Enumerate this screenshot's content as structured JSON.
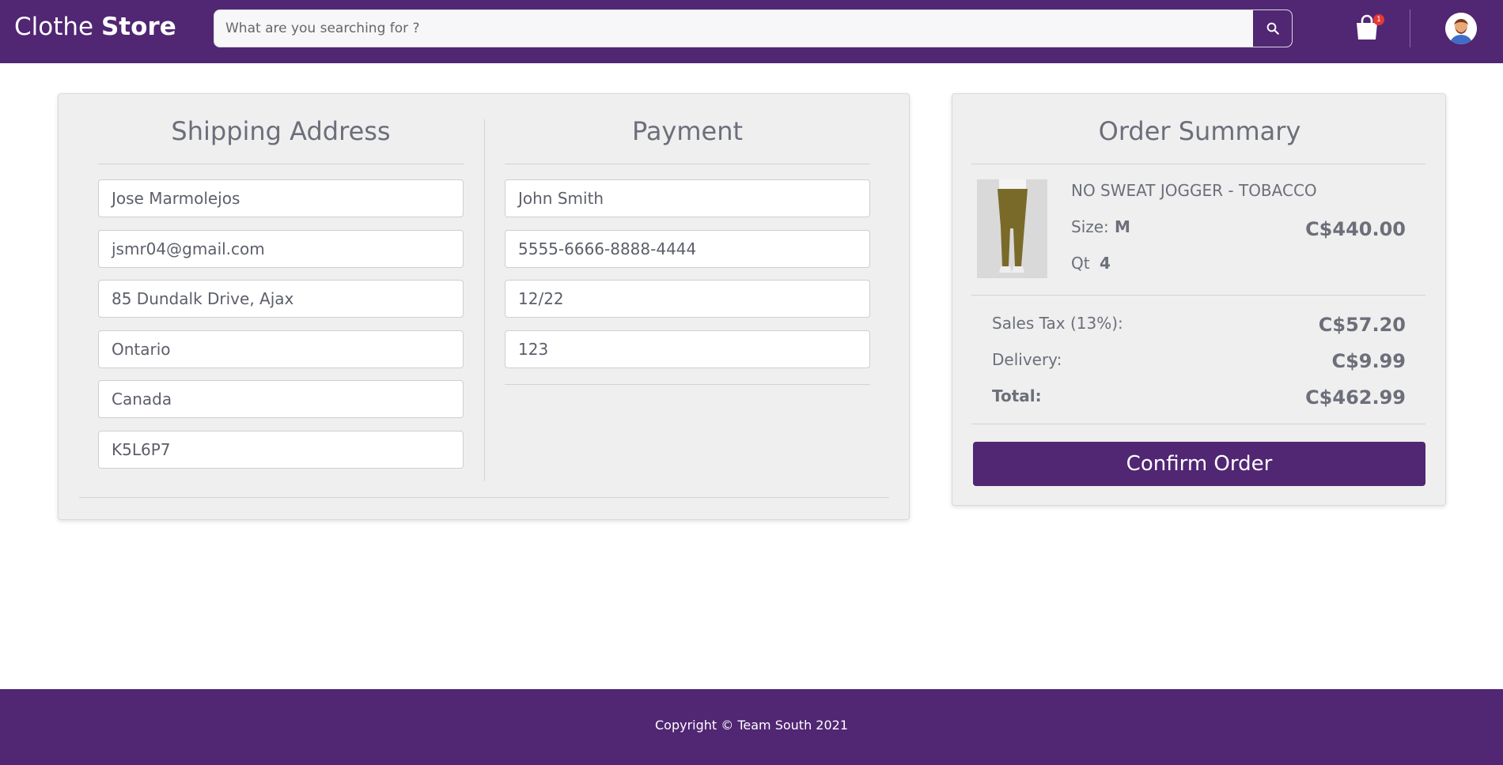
{
  "header": {
    "brand_light": "Clothe",
    "brand_bold": "Store",
    "search_placeholder": "What are you searching for ?",
    "cart_count": "1",
    "icons": {
      "search": "search-icon",
      "cart": "shopping-bag-icon",
      "avatar": "user-avatar"
    }
  },
  "shipping": {
    "title": "Shipping Address",
    "fields": [
      "Jose Marmolejos",
      "jsmr04@gmail.com",
      "85 Dundalk Drive, Ajax",
      "Ontario",
      "Canada",
      "K5L6P7"
    ]
  },
  "payment": {
    "title": "Payment",
    "fields": [
      "John Smith",
      "5555-6666-8888-4444",
      "12/22",
      "123"
    ]
  },
  "summary": {
    "title": "Order Summary",
    "product": {
      "name": "NO SWEAT JOGGER - TOBACCO",
      "size_label": "Size:",
      "size_value": "M",
      "qty_label": "Qt",
      "qty_value": "4",
      "price": "C$440.00"
    },
    "sales_tax_label": "Sales Tax (13%):",
    "sales_tax_value": "C$57.20",
    "delivery_label": "Delivery:",
    "delivery_value": "C$9.99",
    "total_label": "Total:",
    "total_value": "C$462.99",
    "confirm_label": "Confirm Order"
  },
  "footer": {
    "copyright": "Copyright © Team South 2021"
  },
  "colors": {
    "brand": "#512673",
    "card_bg": "#efefef",
    "text": "#6c6f7a",
    "badge": "#e53935"
  }
}
